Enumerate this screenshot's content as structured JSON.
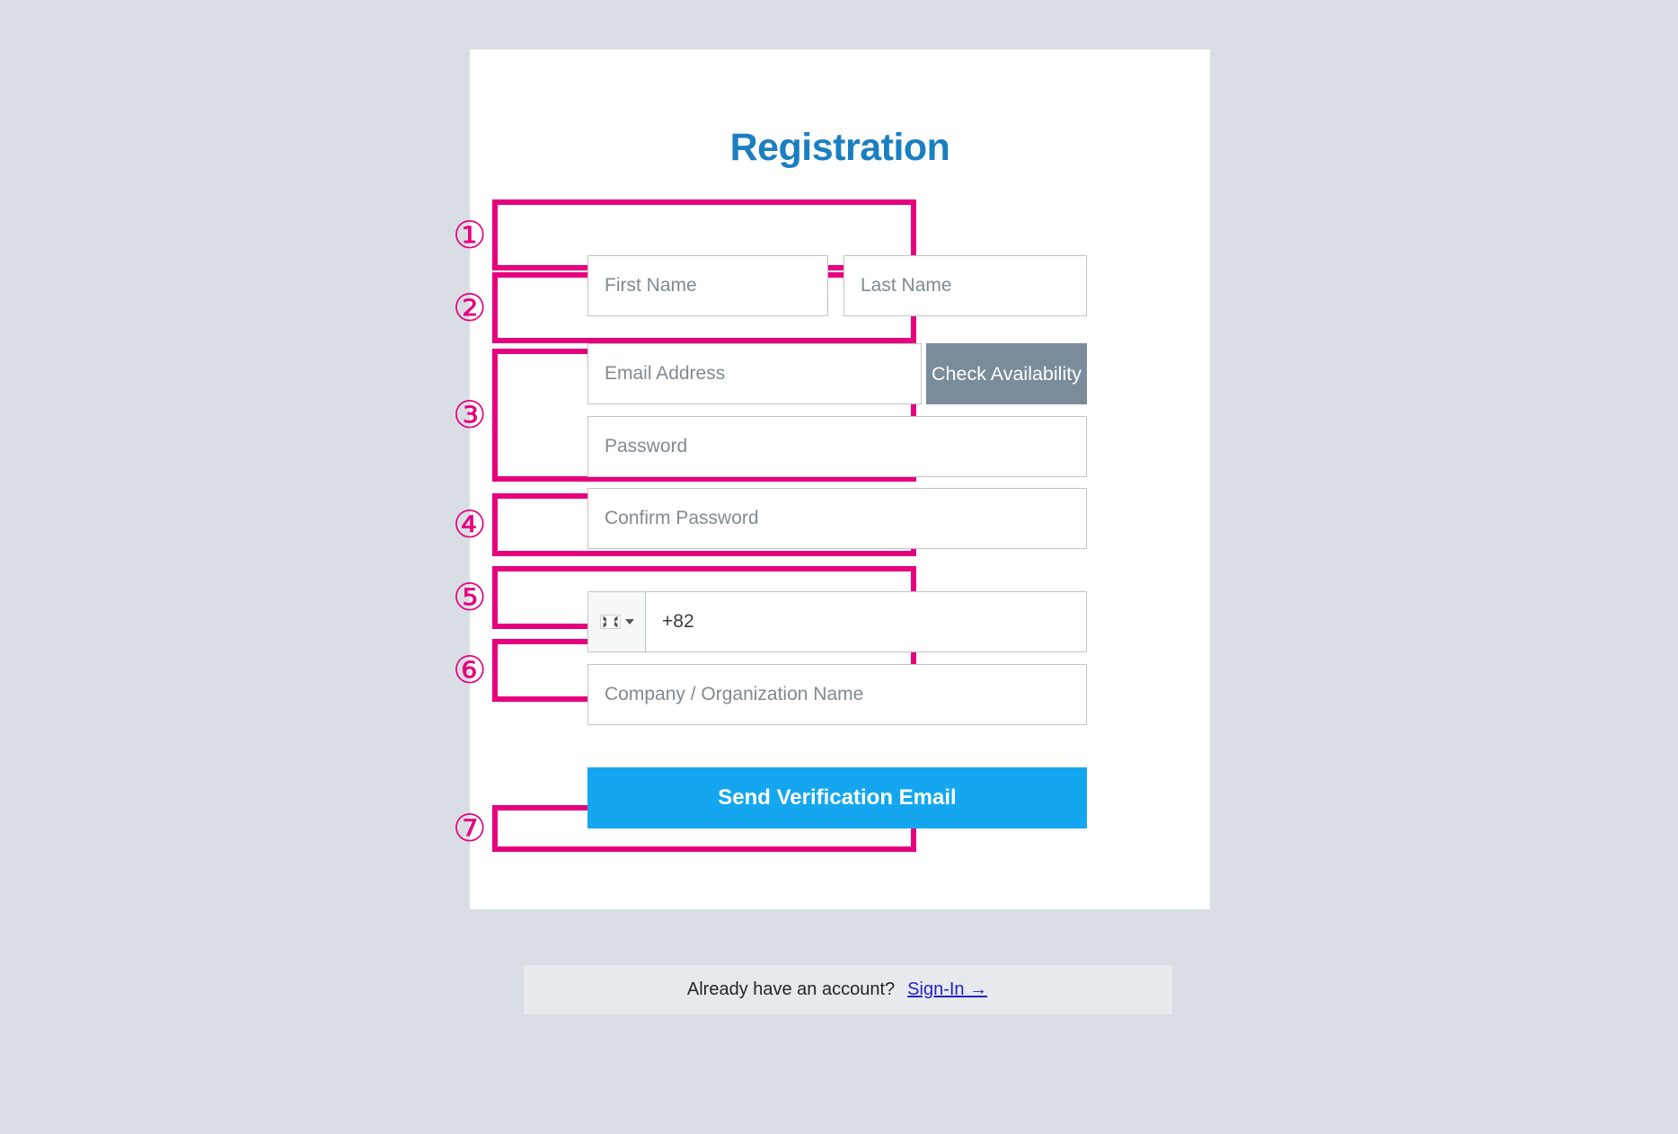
{
  "page": {
    "background_color": "#d9dee5",
    "card_background": "#ffffff",
    "annotation_color": "#e6007e"
  },
  "header": {
    "title": "Registration",
    "title_color": "#1a7fc1"
  },
  "form": {
    "name_row": {
      "first_name_placeholder": "First Name",
      "first_name_value": "",
      "last_name_placeholder": "Last Name",
      "last_name_value": ""
    },
    "email_row": {
      "email_placeholder": "Email Address",
      "email_value": "",
      "check_button_label": "Check Availability",
      "check_button_color": "#7a8b99"
    },
    "password_row": {
      "password_placeholder": "Password",
      "password_value": "",
      "confirm_placeholder": "Confirm Password",
      "confirm_value": ""
    },
    "phone_row": {
      "country_flag": "south-korea-flag-icon",
      "country_code": "KR",
      "dropdown_icon": "chevron-down-icon",
      "phone_value": "+82",
      "phone_placeholder": ""
    },
    "company_row": {
      "company_placeholder": "Company / Organization Name",
      "company_value": ""
    },
    "submit_row": {
      "submit_label": "Send Verification Email",
      "submit_color": "#14a7f0"
    }
  },
  "footer": {
    "prompt_text": "Already have an account?",
    "signin_label": "Sign-In →",
    "signin_color": "#2323c8",
    "bar_color": "#e7eaec"
  },
  "annotations": {
    "markers": [
      {
        "id": 1,
        "glyph": "①",
        "target": "name-row"
      },
      {
        "id": 2,
        "glyph": "②",
        "target": "email-row"
      },
      {
        "id": 3,
        "glyph": "③",
        "target": "password-row"
      },
      {
        "id": 4,
        "glyph": "④",
        "target": "phone-row"
      },
      {
        "id": 5,
        "glyph": "⑤",
        "target": "company-row"
      },
      {
        "id": 6,
        "glyph": "⑥",
        "target": "submit-row"
      },
      {
        "id": 7,
        "glyph": "⑦",
        "target": "footer-row"
      }
    ]
  }
}
